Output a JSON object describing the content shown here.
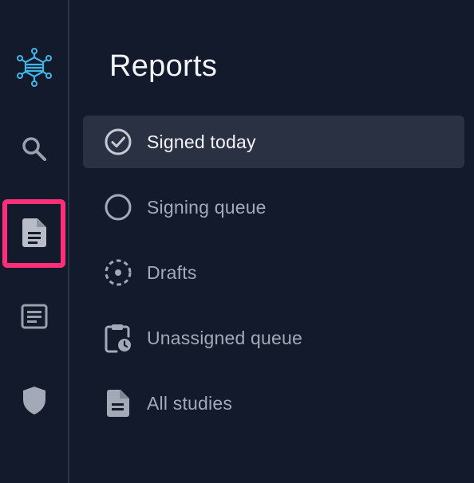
{
  "rail": {
    "items": [
      {
        "id": "logo",
        "icon": "network-logo-icon"
      },
      {
        "id": "search",
        "icon": "search-icon"
      },
      {
        "id": "reports",
        "icon": "report-document-icon",
        "active": true
      },
      {
        "id": "worklist",
        "icon": "article-icon"
      },
      {
        "id": "security",
        "icon": "shield-icon"
      }
    ]
  },
  "panel": {
    "title": "Reports",
    "items": [
      {
        "label": "Signed today",
        "icon": "check-circle-icon",
        "selected": true
      },
      {
        "label": "Signing queue",
        "icon": "circle-outline-icon"
      },
      {
        "label": "Drafts",
        "icon": "dashed-circle-icon"
      },
      {
        "label": "Unassigned queue",
        "icon": "clipboard-clock-icon"
      },
      {
        "label": "All studies",
        "icon": "document-icon"
      }
    ]
  },
  "colors": {
    "background": "#131a2b",
    "selected_row": "#2a3142",
    "active_highlight": "#ff2e78",
    "logo_accent": "#3fb6e6",
    "text_primary": "#f2f4f8",
    "text_muted": "#a3a9b6"
  }
}
